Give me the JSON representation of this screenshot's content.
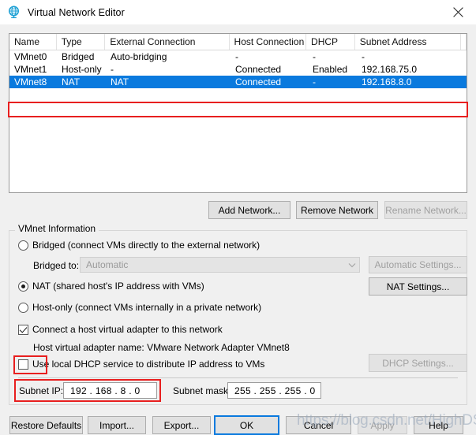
{
  "window": {
    "title": "Virtual Network Editor",
    "icon": "network-globe-icon",
    "close_label": "×",
    "accent_color": "#0a7ade",
    "annotation_color": "#e81f1f"
  },
  "network_table": {
    "columns": [
      "Name",
      "Type",
      "External Connection",
      "Host Connection",
      "DHCP",
      "Subnet Address"
    ],
    "rows": [
      {
        "name": "VMnet0",
        "type": "Bridged",
        "external_connection": "Auto-bridging",
        "host_connection": "-",
        "dhcp": "-",
        "subnet_address": "-",
        "selected": false
      },
      {
        "name": "VMnet1",
        "type": "Host-only",
        "external_connection": "-",
        "host_connection": "Connected",
        "dhcp": "Enabled",
        "subnet_address": "192.168.75.0",
        "selected": false
      },
      {
        "name": "VMnet8",
        "type": "NAT",
        "external_connection": "NAT",
        "host_connection": "Connected",
        "dhcp": "-",
        "subnet_address": "192.168.8.0",
        "selected": true
      }
    ]
  },
  "list_buttons": {
    "add_network": "Add Network...",
    "remove_network": "Remove Network",
    "rename_network": "Rename Network..."
  },
  "vmnet_information": {
    "group_title": "VMnet Information",
    "bridged_label": "Bridged (connect VMs directly to the external network)",
    "bridged_to_label": "Bridged to:",
    "bridged_to_value": "Automatic",
    "bridged_to_arrow": "chevron-down-icon",
    "automatic_settings": "Automatic Settings...",
    "nat_label": "NAT (shared host's IP address with VMs)",
    "nat_settings": "NAT Settings...",
    "host_only_label": "Host-only (connect VMs internally in a private network)",
    "connect_adapter_label": "Connect a host virtual adapter to this network",
    "adapter_name_label": "Host virtual adapter name: VMware Network Adapter VMnet8",
    "use_dhcp_label": "Use local DHCP service to distribute IP address to VMs",
    "dhcp_settings": "DHCP Settings...",
    "subnet_ip_label": "Subnet IP:",
    "subnet_ip_value": "192 . 168 .  8  .  0",
    "subnet_mask_label": "Subnet mask:",
    "subnet_mask_value": "255 . 255 . 255 .  0"
  },
  "dialog_buttons": {
    "restore_defaults": "Restore Defaults",
    "import": "Import...",
    "export": "Export...",
    "ok": "OK",
    "cancel": "Cancel",
    "apply": "Apply",
    "help": "Help"
  },
  "watermark": {
    "text": "https://blog.csdn.net/HighDS"
  }
}
